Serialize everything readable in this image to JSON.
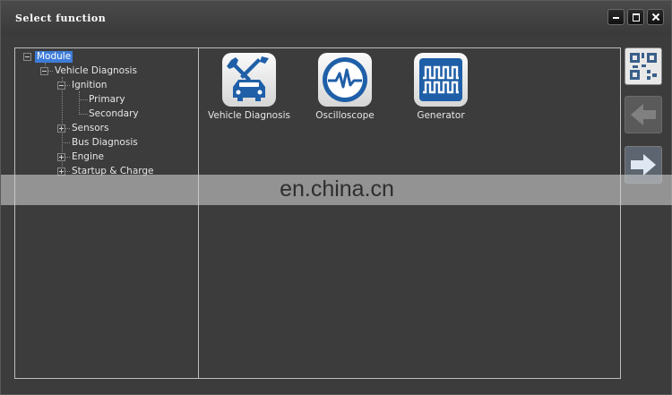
{
  "window": {
    "title": "Select function",
    "buttons": [
      "minimize",
      "maximize",
      "close"
    ]
  },
  "tree": {
    "root": "Module",
    "nodes": [
      {
        "label": "Vehicle Diagnosis",
        "state": "expanded"
      },
      {
        "label": "Ignition",
        "state": "expanded"
      },
      {
        "label": "Primary",
        "state": "leaf"
      },
      {
        "label": "Secondary",
        "state": "leaf"
      },
      {
        "label": "Sensors",
        "state": "collapsed"
      },
      {
        "label": "Bus Diagnosis",
        "state": "leaf"
      },
      {
        "label": "Engine",
        "state": "collapsed"
      },
      {
        "label": "Startup & Charge",
        "state": "collapsed"
      }
    ]
  },
  "apps": [
    {
      "label": "Vehicle Diagnosis",
      "icon": "wrench-screwdriver-car-icon"
    },
    {
      "label": "Oscilloscope",
      "icon": "oscilloscope-waveform-icon"
    },
    {
      "label": "Generator",
      "icon": "generator-square-wave-icon"
    }
  ],
  "side_buttons": {
    "qr_icon": "qr-code-icon",
    "back_icon": "arrow-left-icon",
    "forward_icon": "arrow-right-icon"
  },
  "watermark": "en.china.cn",
  "colors": {
    "selection": "#3e7cd8",
    "icon_blue": "#1f5fa8",
    "background": "#3c3c3c"
  }
}
